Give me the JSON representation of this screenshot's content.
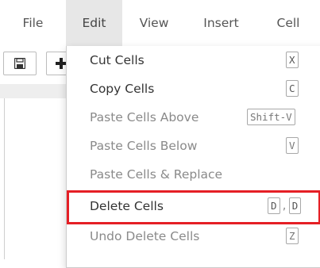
{
  "menubar": {
    "items": [
      {
        "label": "File"
      },
      {
        "label": "Edit"
      },
      {
        "label": "View"
      },
      {
        "label": "Insert"
      },
      {
        "label": "Cell"
      }
    ],
    "active": "Edit"
  },
  "toolbar": {
    "save_icon": "floppy-disk-icon",
    "add_icon": "plus-icon"
  },
  "edit_menu": {
    "items": [
      {
        "label": "Cut Cells",
        "shortcut": [
          "X"
        ],
        "enabled": true
      },
      {
        "label": "Copy Cells",
        "shortcut": [
          "C"
        ],
        "enabled": true
      },
      {
        "label": "Paste Cells Above",
        "shortcut": [
          "Shift-V"
        ],
        "enabled": false
      },
      {
        "label": "Paste Cells Below",
        "shortcut": [
          "V"
        ],
        "enabled": false
      },
      {
        "label": "Paste Cells & Replace",
        "shortcut": [],
        "enabled": false
      },
      {
        "label": "Delete Cells",
        "shortcut": [
          "D",
          "D"
        ],
        "shortcut_separator": ",",
        "enabled": true,
        "highlighted": true
      },
      {
        "label": "Undo Delete Cells",
        "shortcut": [
          "Z"
        ],
        "enabled": false
      }
    ]
  },
  "colors": {
    "highlight_border": "#e51f25",
    "active_menu_bg": "#e7e7e7"
  }
}
